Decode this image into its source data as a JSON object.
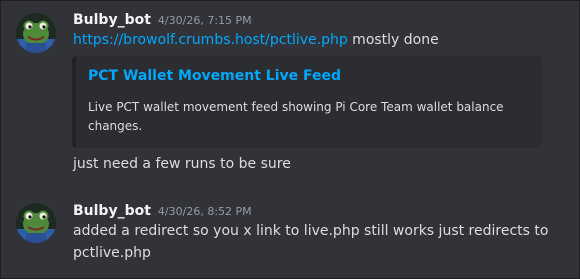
{
  "messages": [
    {
      "username": "Bulby_bot",
      "timestamp": "4/30/26, 7:15 PM",
      "link_text": "https://browolf.crumbs.host/pctlive.php",
      "text_after_link": " mostly done",
      "embed": {
        "title": "PCT Wallet Movement Live Feed",
        "description": "Live PCT wallet movement feed showing Pi Core Team wallet balance changes."
      },
      "followup": "just need a few runs to be sure"
    },
    {
      "username": "Bulby_bot",
      "timestamp": "4/30/26, 8:52 PM",
      "line1": "added a redirect so you x link to live.php still works just redirects to",
      "line2": "pctlive.php"
    }
  ],
  "icons": {
    "avatar": "frog-avatar-icon"
  },
  "colors": {
    "background": "#323339",
    "link": "#00a8fc",
    "embed_bg": "#2b2d31",
    "username": "#f2f3f5",
    "timestamp": "#949ba4"
  }
}
